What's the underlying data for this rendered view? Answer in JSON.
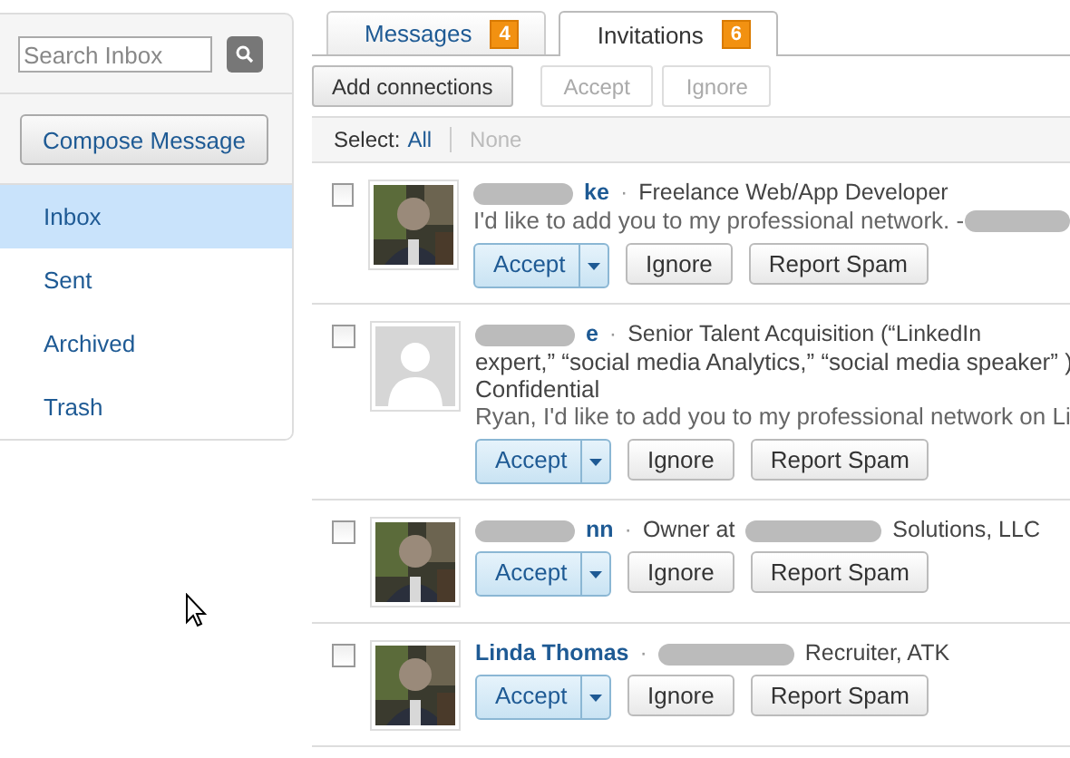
{
  "sidebar": {
    "search": {
      "placeholder": "Search Inbox"
    },
    "compose_button": "Compose Message",
    "items": [
      {
        "label": "Inbox",
        "selected": true
      },
      {
        "label": "Sent",
        "selected": false
      },
      {
        "label": "Archived",
        "selected": false
      },
      {
        "label": "Trash",
        "selected": false
      }
    ]
  },
  "tabs": [
    {
      "label": "Messages",
      "badge": "4",
      "selected": false
    },
    {
      "label": "Invitations",
      "badge": "6",
      "selected": true
    }
  ],
  "toolbar": [
    {
      "label": "Add connections",
      "disabled": false
    },
    {
      "label": "Accept",
      "disabled": true
    },
    {
      "label": "Ignore",
      "disabled": true
    }
  ],
  "select_bar": {
    "label": "Select:",
    "options": [
      {
        "label": "All",
        "disabled": false
      },
      {
        "label": "None",
        "disabled": true
      }
    ]
  },
  "invitations": [
    {
      "checked": false,
      "photo": {
        "kind": "picture"
      },
      "name": [
        {
          "kind": "redaction"
        },
        {
          "kind": "text",
          "text": "ke"
        }
      ],
      "separator": "·",
      "headline": [
        [
          {
            "kind": "text",
            "text": "Freelance Web/App Developer"
          }
        ]
      ],
      "message": [
        {
          "kind": "text",
          "text": "I'd like to add you to my professional network. -"
        },
        {
          "kind": "redaction"
        }
      ],
      "actions": [
        "Accept",
        "Ignore",
        "Report Spam"
      ]
    },
    {
      "checked": false,
      "photo": {
        "kind": "placeholder"
      },
      "name": [
        {
          "kind": "redaction"
        },
        {
          "kind": "text",
          "text": "e"
        }
      ],
      "separator": "·",
      "headline": [
        [
          {
            "kind": "text",
            "text": "Senior Talent Acquisition (“LinkedIn"
          }
        ],
        [
          {
            "kind": "text",
            "text": "expert,” “social media Analytics,” “social media speaker” )"
          }
        ],
        [
          {
            "kind": "text",
            "text": "Confidential"
          }
        ]
      ],
      "message": [
        {
          "kind": "text",
          "text": "Ryan, I'd like to add you to my professional network on Li"
        }
      ],
      "actions": [
        "Accept",
        "Ignore",
        "Report Spam"
      ]
    },
    {
      "checked": false,
      "photo": {
        "kind": "picture"
      },
      "name": [
        {
          "kind": "redaction"
        },
        {
          "kind": "text",
          "text": "nn"
        }
      ],
      "separator": "·",
      "headline": [
        [
          {
            "kind": "text",
            "text": "Owner at"
          },
          {
            "kind": "redaction"
          },
          {
            "kind": "text",
            "text": "Solutions, LLC"
          }
        ]
      ],
      "actions": [
        "Accept",
        "Ignore",
        "Report Spam"
      ]
    },
    {
      "checked": false,
      "photo": {
        "kind": "picture"
      },
      "name": [
        {
          "kind": "text",
          "text": "Linda Thomas"
        }
      ],
      "separator": "·",
      "headline": [
        [
          {
            "kind": "redaction"
          },
          {
            "kind": "text",
            "text": "Recruiter, ATK"
          }
        ]
      ],
      "actions": [
        "Accept",
        "Ignore",
        "Report Spam"
      ]
    }
  ]
}
